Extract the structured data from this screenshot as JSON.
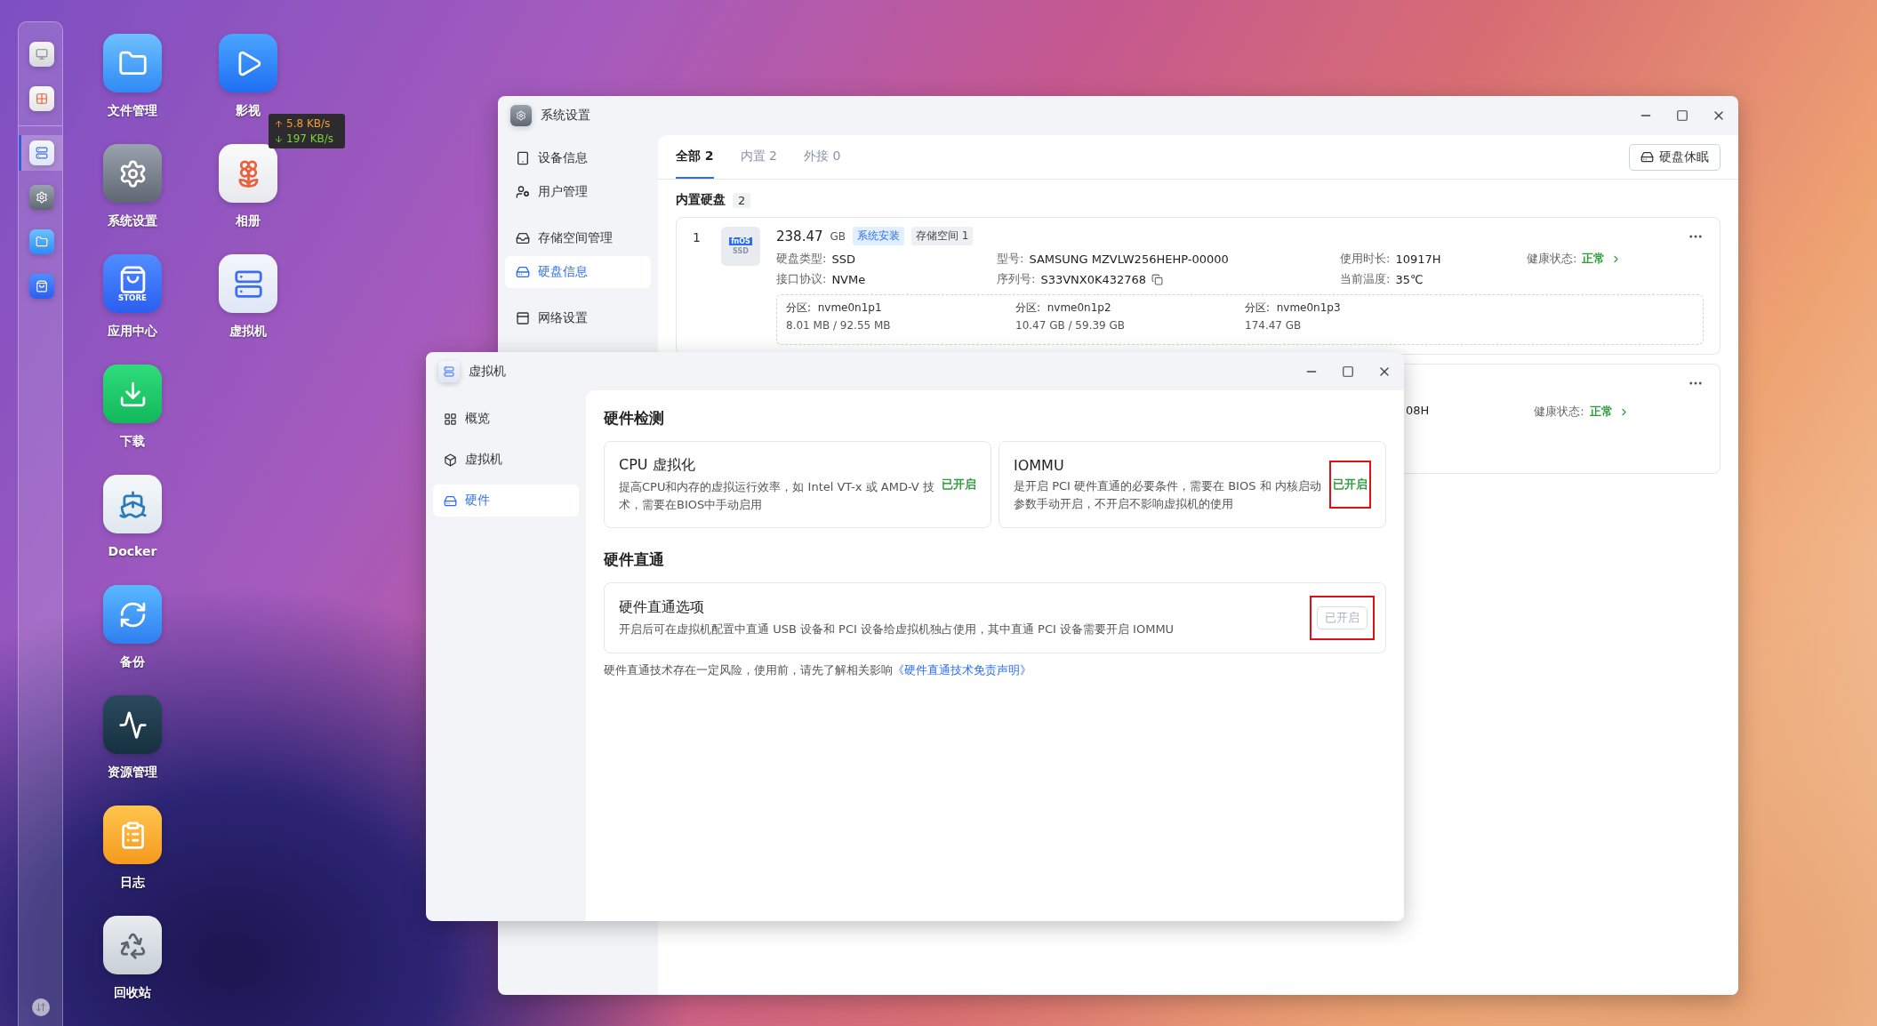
{
  "dock": {
    "items": [
      {
        "kind": "monitor",
        "selected": false
      },
      {
        "kind": "apps",
        "selected": false
      },
      {
        "kind": "vm",
        "selected": true
      },
      {
        "kind": "gear",
        "selected": false
      },
      {
        "kind": "folder",
        "selected": false
      },
      {
        "kind": "store",
        "selected": false
      }
    ]
  },
  "net_widget": {
    "upload": "5.8 KB/s",
    "download": "197 KB/s"
  },
  "desktop": {
    "icons": [
      {
        "label": "文件管理",
        "kind": "folder"
      },
      {
        "label": "系统设置",
        "kind": "gear"
      },
      {
        "label": "应用中心",
        "kind": "store",
        "icon_text": "STORE"
      },
      {
        "label": "下载",
        "kind": "download"
      },
      {
        "label": "Docker",
        "kind": "docker"
      },
      {
        "label": "备份",
        "kind": "backup"
      },
      {
        "label": "资源管理",
        "kind": "chart"
      },
      {
        "label": "日志",
        "kind": "log"
      },
      {
        "label": "回收站",
        "kind": "trash"
      },
      {
        "label": "影视",
        "kind": "video"
      },
      {
        "label": "相册",
        "kind": "photos"
      },
      {
        "label": "虚拟机",
        "kind": "vm"
      }
    ]
  },
  "settings_window": {
    "title": "系统设置",
    "sidebar_groups": [
      {
        "items": [
          {
            "label": "设备信息",
            "kind": "device",
            "selected": false
          },
          {
            "label": "用户管理",
            "kind": "user",
            "selected": false
          }
        ]
      },
      {
        "items": [
          {
            "label": "存储空间管理",
            "kind": "storage",
            "selected": false
          },
          {
            "label": "硬盘信息",
            "kind": "disk",
            "selected": true
          }
        ]
      },
      {
        "items": [
          {
            "label": "网络设置",
            "kind": "network",
            "selected": false
          }
        ]
      }
    ],
    "tabs": [
      {
        "label": "全部 2",
        "selected": true
      },
      {
        "label": "内置 2",
        "selected": false
      },
      {
        "label": "外接 0",
        "selected": false
      }
    ],
    "hibernate_button": "硬盘休眠",
    "section": {
      "title": "内置硬盘",
      "count": "2"
    },
    "disk": {
      "index": "1",
      "icon_labels": [
        "fnOS",
        "SSD"
      ],
      "size": "238.47",
      "unit": "GB",
      "tags": [
        {
          "label": "系统安装",
          "kind": "primary"
        },
        {
          "label": "存储空间 1",
          "kind": "neutral"
        }
      ],
      "rows": [
        [
          {
            "label": "硬盘类型:",
            "value": "SSD",
            "kind": "plain"
          },
          {
            "label": "型号:",
            "value": "SAMSUNG MZVLW256HEHP-00000",
            "kind": "plain"
          },
          {
            "label": "使用时长:",
            "value": "10917H",
            "kind": "plain"
          },
          {
            "label": "健康状态:",
            "value": "正常",
            "kind": "health"
          }
        ],
        [
          {
            "label": "接口协议:",
            "value": "NVMe",
            "kind": "plain"
          },
          {
            "label": "序列号:",
            "value": "S33VNX0K432768",
            "kind": "copy"
          },
          {
            "label": "当前温度:",
            "value": "35℃",
            "kind": "plain"
          }
        ]
      ],
      "partitions": [
        {
          "label": "分区:",
          "name": "nvme0n1p1",
          "usage": "8.01 MB / 92.55 MB"
        },
        {
          "label": "分区:",
          "name": "nvme0n1p2",
          "usage": "10.47 GB / 59.39 GB"
        },
        {
          "label": "分区:",
          "name": "nvme0n1p3",
          "usage": "174.47 GB"
        }
      ]
    },
    "disk_2": {
      "usage_fragment": "08H",
      "health_label": "健康状态:",
      "health": "正常"
    }
  },
  "vm_window": {
    "title": "虚拟机",
    "sidebar": [
      {
        "label": "概览",
        "kind": "grid",
        "selected": false
      },
      {
        "label": "虚拟机",
        "kind": "box",
        "selected": false
      },
      {
        "label": "硬件",
        "kind": "disk",
        "selected": true
      }
    ],
    "detection": {
      "title": "硬件检测",
      "cards": [
        {
          "title": "CPU 虚拟化",
          "description": "提高CPU和内存的虚拟运行效率，如 Intel VT-x 或 AMD-V 技术，需要在BIOS中手动启用",
          "status": "已开启",
          "highlighted": false
        },
        {
          "title": "IOMMU",
          "description": "是开启 PCI 硬件直通的必要条件，需要在 BIOS 和 内核启动参数手动开启，不开启不影响虚拟机的使用",
          "status": "已开启",
          "highlighted": true
        }
      ]
    },
    "passthrough": {
      "title": "硬件直通",
      "card": {
        "title": "硬件直通选项",
        "description": "开启后可在虚拟机配置中直通 USB 设备和 PCI 设备给虚拟机独占使用，其中直通 PCI 设备需要开启 IOMMU",
        "button": "已开启",
        "disabled": true,
        "highlighted": true
      }
    },
    "note": {
      "text": "硬件直通技术存在一定风险，使用前，请先了解相关影响",
      "link": "《硬件直通技术免责声明》"
    }
  }
}
